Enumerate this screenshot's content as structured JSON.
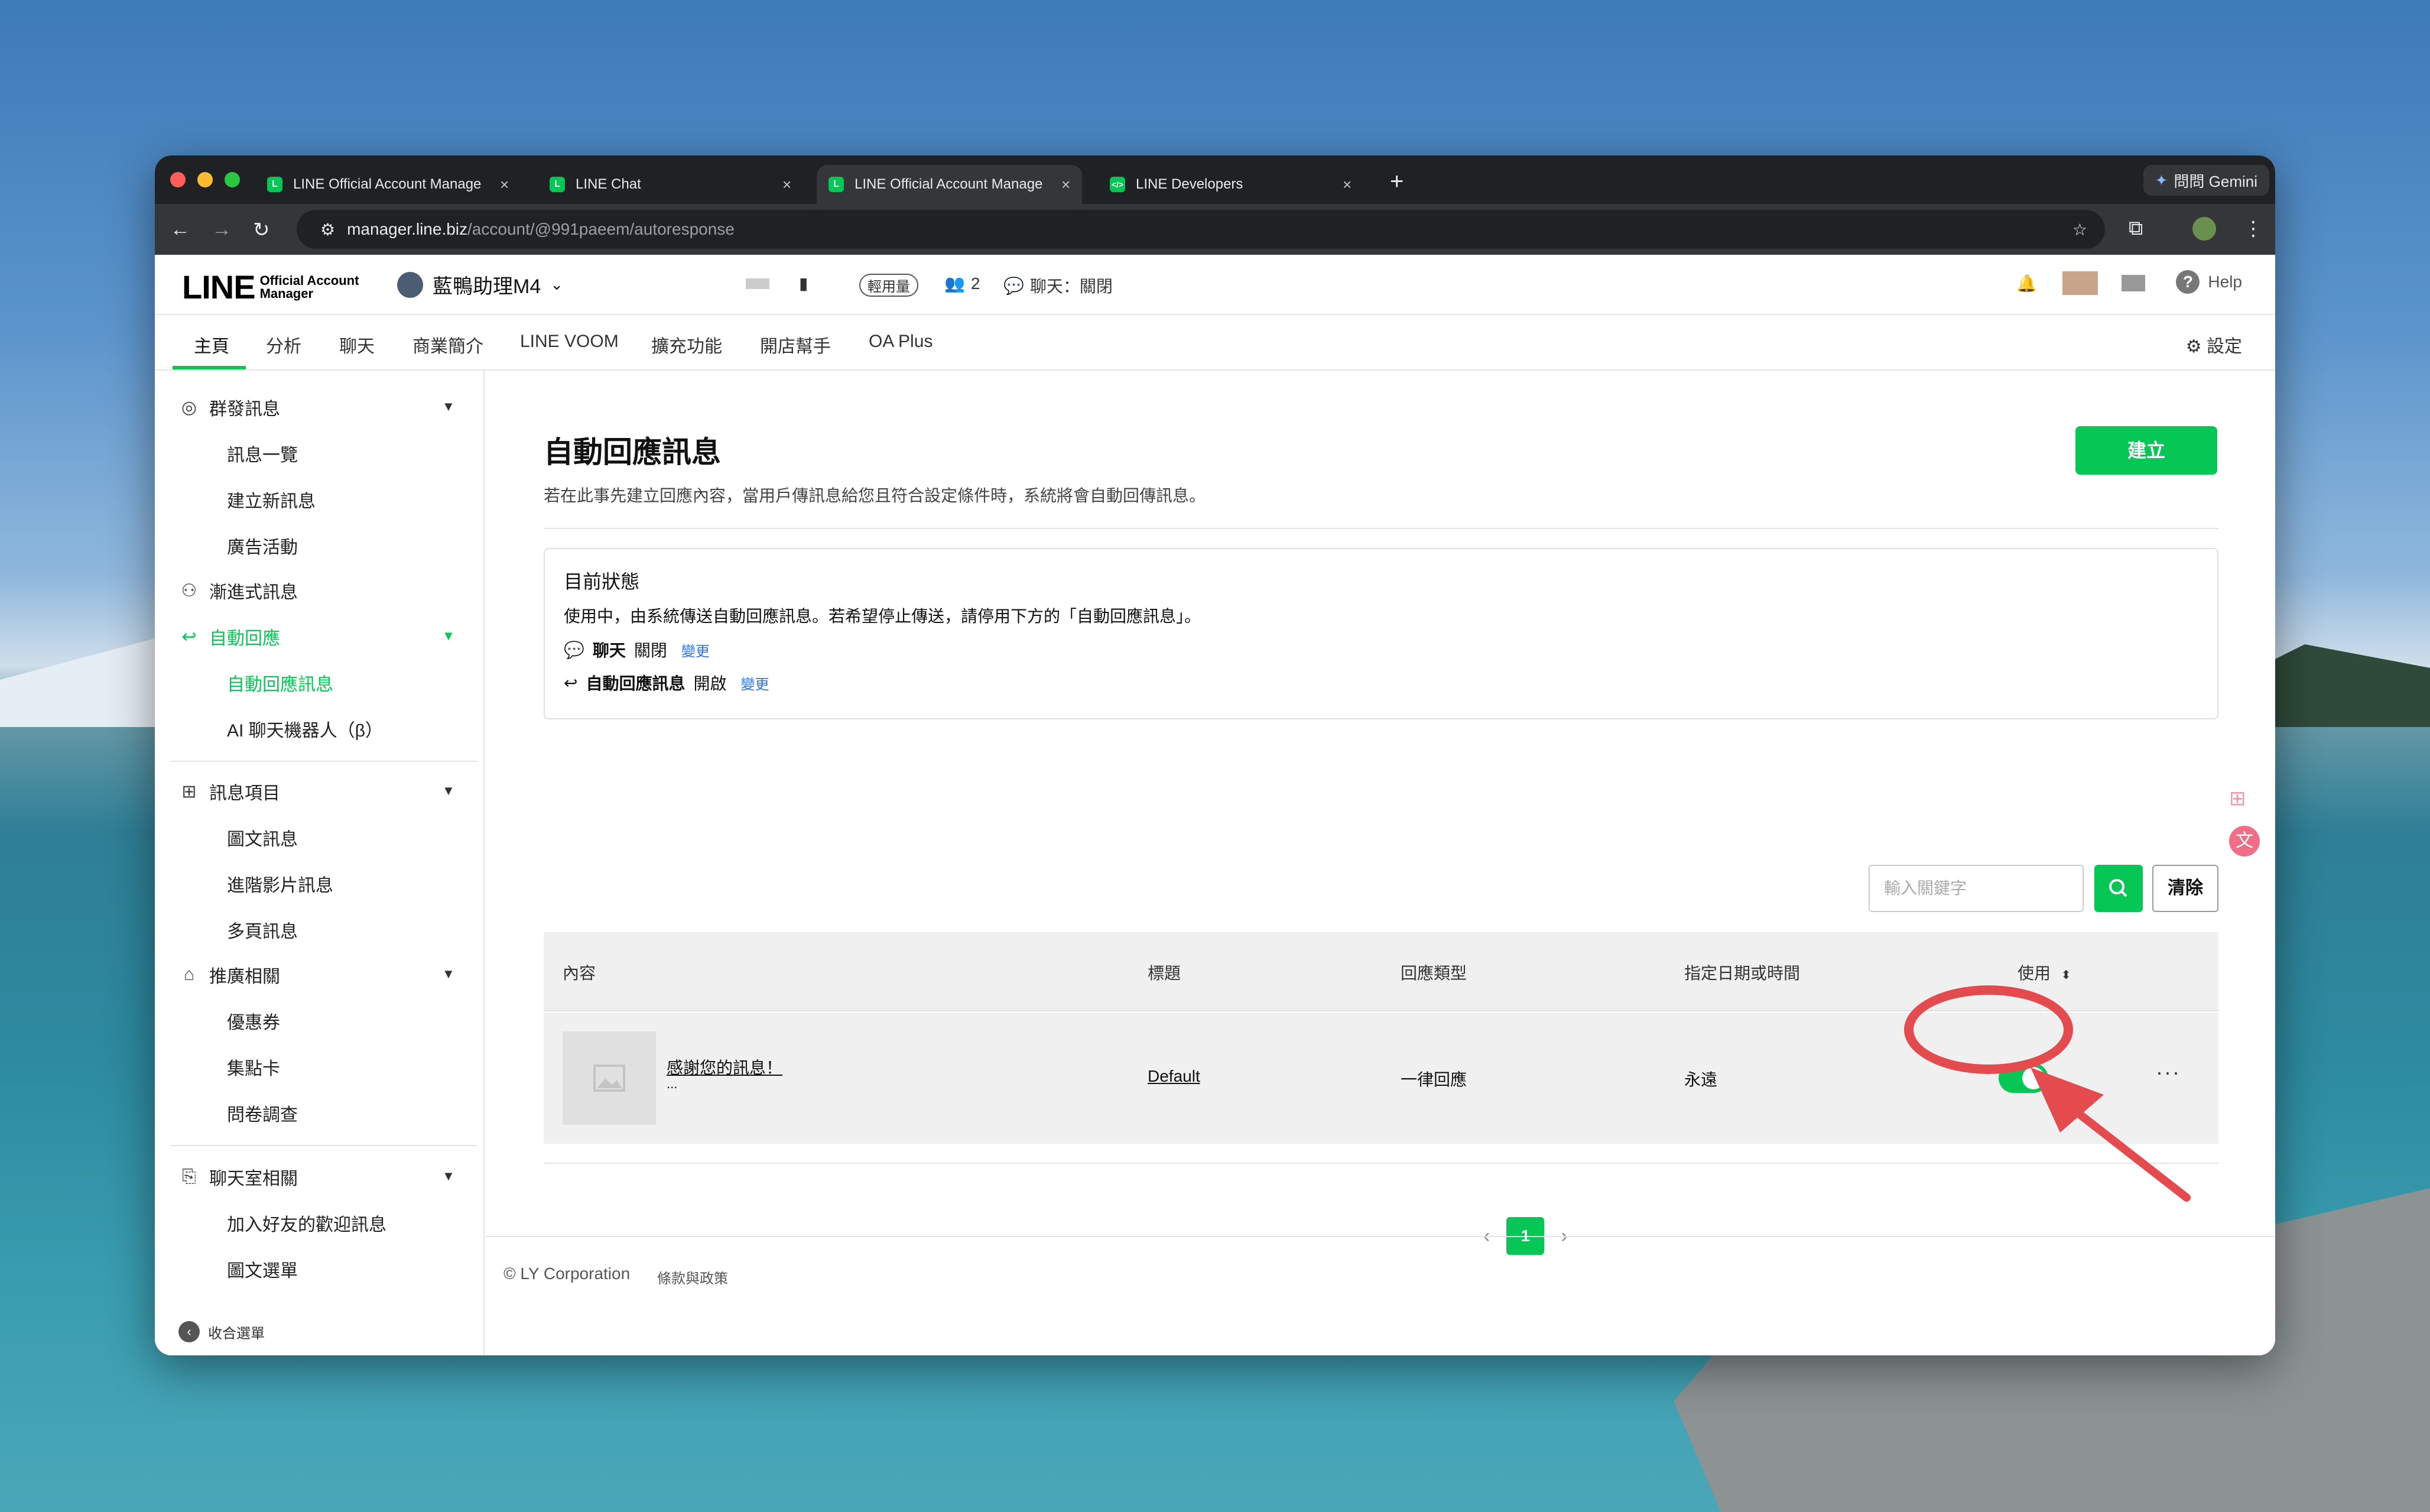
{
  "browser": {
    "tabs": [
      {
        "title": "LINE Official Account Manage",
        "close": "×"
      },
      {
        "title": "LINE Chat",
        "close": "×"
      },
      {
        "title": "LINE Official Account Manage",
        "close": "×"
      },
      {
        "title": "LINE Developers",
        "close": "×"
      }
    ],
    "new_tab": "+",
    "gemini": "問問 Gemini",
    "url_host": "manager.line.biz",
    "url_path": "/account/@991paeem/autoresponse"
  },
  "header": {
    "logo_big": "LINE",
    "logo_small_1": "Official Account",
    "logo_small_2": "Manager",
    "account_name": "藍鴨助理M4",
    "plan_badge": "輕用量",
    "friends_count": "2",
    "chat_status": "聊天：關閉",
    "help": "Help"
  },
  "mainnav": {
    "items": [
      "主頁",
      "分析",
      "聊天",
      "商業簡介",
      "LINE VOOM",
      "擴充功能",
      "開店幫手",
      "OA Plus"
    ],
    "settings": "設定"
  },
  "sidebar": {
    "broadcast": "群發訊息",
    "message_list": "訊息一覽",
    "new_message": "建立新訊息",
    "ad": "廣告活動",
    "step_message": "漸進式訊息",
    "auto_reply": "自動回應",
    "auto_reply_message": "自動回應訊息",
    "ai_bot": "AI 聊天機器人（β）",
    "message_items": "訊息項目",
    "rich_message": "圖文訊息",
    "rich_video": "進階影片訊息",
    "card_message": "多頁訊息",
    "promotion": "推廣相關",
    "coupon": "優惠券",
    "reward_card": "集點卡",
    "survey": "問卷調查",
    "chat_related": "聊天室相關",
    "greeting": "加入好友的歡迎訊息",
    "rich_menu": "圖文選單",
    "collapse": "收合選單"
  },
  "main": {
    "title": "自動回應訊息",
    "description": "若在此事先建立回應內容，當用戶傳訊息給您且符合設定條件時，系統將會自動回傳訊息。",
    "create_button": "建立",
    "status": {
      "title": "目前狀態",
      "desc": "使用中，由系統傳送自動回應訊息。若希望停止傳送，請停用下方的「自動回應訊息」。",
      "chat_label": "聊天",
      "chat_value": "關閉",
      "change": "變更",
      "auto_label": "自動回應訊息",
      "auto_value": "開啟"
    },
    "search_placeholder": "輸入關鍵字",
    "clear_button": "清除",
    "table": {
      "headers": [
        "內容",
        "標題",
        "回應類型",
        "指定日期或時間",
        "使用"
      ],
      "row": {
        "content": "感謝您的訊息！",
        "content_more": "...",
        "title": "Default",
        "type": "一律回應",
        "date": "永遠",
        "enabled": true,
        "more": "···"
      }
    },
    "page": "1"
  },
  "footer": {
    "copyright": "© LY Corporation",
    "terms": "條款與政策"
  },
  "colors": {
    "line_green": "#06c755",
    "annotation_red": "#e34b4e"
  }
}
